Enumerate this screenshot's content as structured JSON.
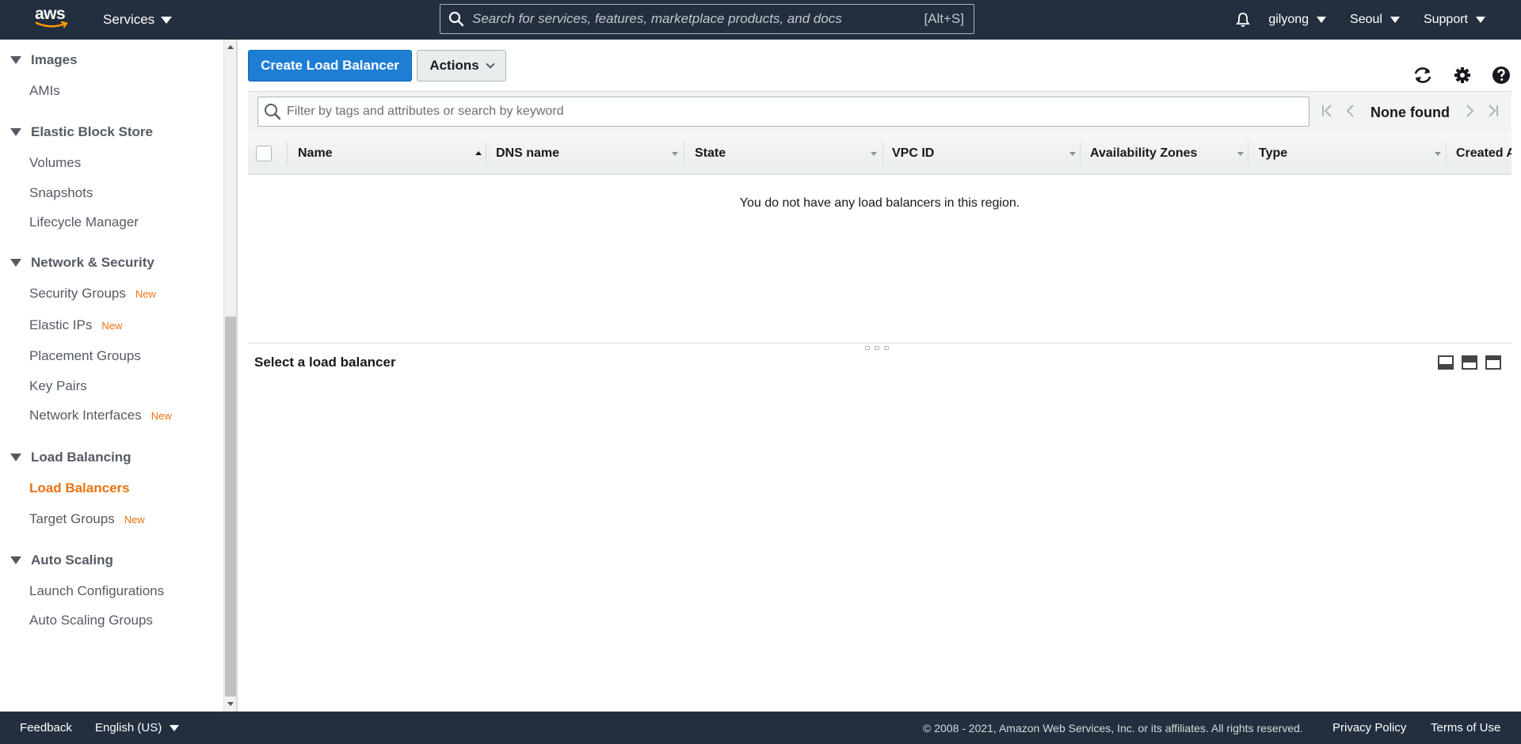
{
  "topnav": {
    "logo_text": "aws",
    "services_label": "Services",
    "search_placeholder": "Search for services, features, marketplace products, and docs",
    "search_shortcut": "[Alt+S]",
    "user": "gilyong",
    "region": "Seoul",
    "support": "Support"
  },
  "sidebar": {
    "sections": [
      {
        "label": "Images",
        "items": [
          {
            "label": "AMIs",
            "badge": ""
          }
        ]
      },
      {
        "label": "Elastic Block Store",
        "items": [
          {
            "label": "Volumes",
            "badge": ""
          },
          {
            "label": "Snapshots",
            "badge": ""
          },
          {
            "label": "Lifecycle Manager",
            "badge": ""
          }
        ]
      },
      {
        "label": "Network & Security",
        "items": [
          {
            "label": "Security Groups",
            "badge": "New"
          },
          {
            "label": "Elastic IPs",
            "badge": "New"
          },
          {
            "label": "Placement Groups",
            "badge": ""
          },
          {
            "label": "Key Pairs",
            "badge": ""
          },
          {
            "label": "Network Interfaces",
            "badge": "New"
          }
        ]
      },
      {
        "label": "Load Balancing",
        "items": [
          {
            "label": "Load Balancers",
            "badge": "",
            "active": true
          },
          {
            "label": "Target Groups",
            "badge": "New"
          }
        ]
      },
      {
        "label": "Auto Scaling",
        "items": [
          {
            "label": "Launch Configurations",
            "badge": ""
          },
          {
            "label": "Auto Scaling Groups",
            "badge": ""
          }
        ]
      }
    ]
  },
  "toolbar": {
    "create_label": "Create Load Balancer",
    "actions_label": "Actions"
  },
  "filter": {
    "placeholder": "Filter by tags and attributes or search by keyword",
    "pager_text": "None found"
  },
  "table": {
    "columns": [
      "Name",
      "DNS name",
      "State",
      "VPC ID",
      "Availability Zones",
      "Type",
      "Created A"
    ],
    "empty_message": "You do not have any load balancers in this region."
  },
  "details": {
    "title": "Select a load balancer"
  },
  "footer": {
    "feedback": "Feedback",
    "language": "English (US)",
    "copyright": "© 2008 - 2021, Amazon Web Services, Inc. or its affiliates. All rights reserved.",
    "privacy": "Privacy Policy",
    "terms": "Terms of Use"
  },
  "colors": {
    "nav_bg": "#232f3e",
    "primary_button": "#1d7ed4",
    "accent_orange": "#ec7211"
  }
}
